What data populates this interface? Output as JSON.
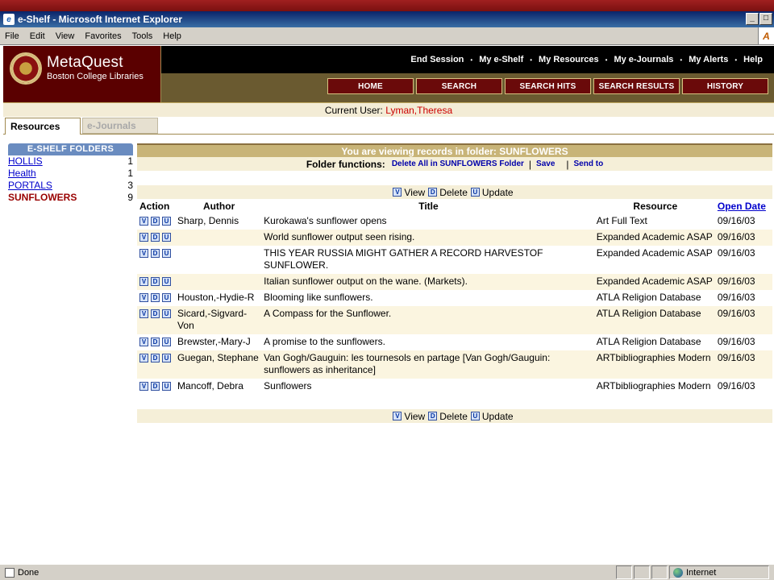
{
  "window": {
    "title": "e-Shelf - Microsoft Internet Explorer"
  },
  "menu": [
    "File",
    "Edit",
    "View",
    "Favorites",
    "Tools",
    "Help"
  ],
  "header": {
    "brand": "MetaQuest",
    "brand_sub": "Boston College Libraries",
    "top_links": [
      "End Session",
      "My e-Shelf",
      "My Resources",
      "My e-Journals",
      "My Alerts",
      "Help"
    ],
    "nav_buttons": [
      "HOME",
      "SEARCH",
      "SEARCH HITS",
      "SEARCH RESULTS",
      "HISTORY"
    ]
  },
  "user": {
    "label": "Current User:",
    "name": "Lyman,Theresa"
  },
  "tabs": {
    "resources": "Resources",
    "ejournals": "e-Journals"
  },
  "sidebar": {
    "heading": "E-SHELF FOLDERS",
    "folders": [
      {
        "name": "HOLLIS",
        "count": "1"
      },
      {
        "name": "Health",
        "count": "1"
      },
      {
        "name": "PORTALS",
        "count": "3"
      },
      {
        "name": "SUNFLOWERS",
        "count": "9"
      }
    ]
  },
  "main": {
    "viewing": "You are viewing records in folder: SUNFLOWERS",
    "folder_functions_label": "Folder functions:",
    "delete_all": "Delete All in SUNFLOWERS Folder",
    "save": "Save",
    "send_to": "Send to",
    "actions": {
      "view": "View",
      "delete": "Delete",
      "update": "Update"
    },
    "icons": {
      "view": "V",
      "delete": "D",
      "update": "U"
    },
    "columns": {
      "action": "Action",
      "author": "Author",
      "title": "Title",
      "resource": "Resource",
      "date": "Open Date"
    },
    "records": [
      {
        "author": "Sharp, Dennis",
        "title": "Kurokawa's sunflower opens",
        "resource": "Art Full Text",
        "date": "09/16/03"
      },
      {
        "author": "",
        "title": "World sunflower output seen rising.",
        "resource": "Expanded Academic ASAP",
        "date": "09/16/03"
      },
      {
        "author": "",
        "title": "THIS YEAR RUSSIA MIGHT GATHER A RECORD HARVESTOF SUNFLOWER.",
        "resource": "Expanded Academic ASAP",
        "date": "09/16/03"
      },
      {
        "author": "",
        "title": "Italian sunflower output on the wane. (Markets).",
        "resource": "Expanded Academic ASAP",
        "date": "09/16/03"
      },
      {
        "author": "Houston,-Hydie-R",
        "title": "Blooming like sunflowers.",
        "resource": "ATLA Religion Database",
        "date": "09/16/03"
      },
      {
        "author": "Sicard,-Sigvard-Von",
        "title": "A Compass for the Sunflower.",
        "resource": "ATLA Religion Database",
        "date": "09/16/03"
      },
      {
        "author": "Brewster,-Mary-J",
        "title": "A promise to the sunflowers.",
        "resource": "ATLA Religion Database",
        "date": "09/16/03"
      },
      {
        "author": "Guegan, Stephane",
        "title": "Van Gogh/Gauguin: les tournesols en partage [Van Gogh/Gauguin: sunflowers as inheritance]",
        "resource": "ARTbibliographies Modern",
        "date": "09/16/03"
      },
      {
        "author": "Mancoff, Debra",
        "title": "Sunflowers",
        "resource": "ARTbibliographies Modern",
        "date": "09/16/03"
      }
    ]
  },
  "status": {
    "text": "Done",
    "zone": "Internet"
  },
  "colors": {
    "title_bar": "#0a246a",
    "banner": "#c8b478",
    "user_name": "#cc0000",
    "link": "#0000cc",
    "nav_button": "#6a0a0a"
  }
}
